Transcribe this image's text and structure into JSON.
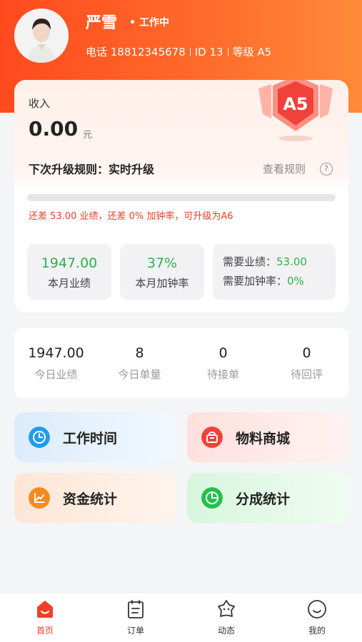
{
  "profile": {
    "name": "严雪",
    "status": "工作中",
    "phone": "电话 18812345678",
    "id_text": "ID 13",
    "level_text": "等级 A5"
  },
  "income": {
    "label": "收入",
    "value": "0.00",
    "unit": "元",
    "badge_level": "A5"
  },
  "upgrade": {
    "title": "下次升级规则：实时升级",
    "rule_link": "查看规则",
    "help_glyph": "?",
    "progress": 0,
    "tip": "还差 53.00 业绩，还差 0% 加钟率，可升级为A6"
  },
  "month_stats": [
    {
      "value": "1947.00",
      "label": "本月业绩"
    },
    {
      "value": "37%",
      "label": "本月加钟率"
    }
  ],
  "requirements": {
    "perf_label": "需要业绩：",
    "perf_value": "53.00",
    "rate_label": "需要加钟率：",
    "rate_value": "0%"
  },
  "today": [
    {
      "value": "1947.00",
      "label": "今日业绩"
    },
    {
      "value": "8",
      "label": "今日单量"
    },
    {
      "value": "0",
      "label": "待接单"
    },
    {
      "value": "0",
      "label": "待回评"
    }
  ],
  "menu": [
    {
      "label": "工作时间",
      "icon": "clock-icon"
    },
    {
      "label": "物料商城",
      "icon": "shop-bag-icon"
    },
    {
      "label": "资金统计",
      "icon": "chart-icon"
    },
    {
      "label": "分成统计",
      "icon": "pie-icon"
    }
  ],
  "tabs": [
    {
      "label": "首页",
      "icon": "home-icon",
      "active": true
    },
    {
      "label": "订单",
      "icon": "order-icon",
      "active": false
    },
    {
      "label": "动态",
      "icon": "moments-icon",
      "active": false
    },
    {
      "label": "我的",
      "icon": "profile-icon",
      "active": false
    }
  ],
  "colors": {
    "brand": "#ff4a1e",
    "success": "#2db24a",
    "warning": "#e8402a"
  }
}
